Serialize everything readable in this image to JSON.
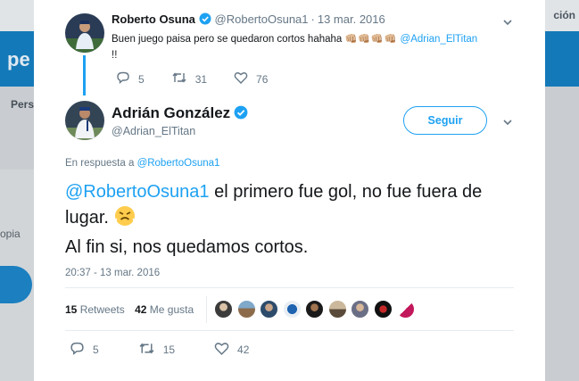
{
  "background": {
    "top_right_text": "ción",
    "banner_text": "pe",
    "tab_text": "Pers",
    "side_text": "opia"
  },
  "parent_tweet": {
    "name": "Roberto Osuna",
    "handle": "@RobertoOsuna1",
    "separator": "·",
    "date": "13 mar. 2016",
    "text_before": "Buen juego paisa pero se quedaron cortos hahaha",
    "emojis": "👊🏼👊🏼👊🏼👊🏼",
    "mention": "@Adrian_ElTitan",
    "text_after": "!!",
    "replies": "5",
    "retweets": "31",
    "likes": "76"
  },
  "main_tweet": {
    "name": "Adrián González",
    "handle": "@Adrian_ElTitan",
    "follow_label": "Seguir",
    "reply_prefix": "En respuesta a",
    "reply_mention": "@RobertoOsuna1",
    "mention": "@RobertoOsuna1",
    "line1_rest": " el primero fue gol, no fue fuera de lugar.",
    "line2": "Al fin si, nos quedamos cortos.",
    "timestamp": "20:37 - 13 mar. 2016",
    "retweets_count": "15",
    "retweets_label": "Retweets",
    "likes_count": "42",
    "likes_label": "Me gusta",
    "replies": "5",
    "retweets": "15",
    "likes": "42"
  },
  "colors": {
    "accent": "#1da1f2",
    "text_primary": "#14171a",
    "text_secondary": "#657786",
    "banner": "#1479b8"
  },
  "icons": [
    "verified-badge-icon",
    "chevron-down-icon",
    "reply-icon",
    "retweet-icon",
    "like-icon",
    "angry-face-emoji"
  ]
}
